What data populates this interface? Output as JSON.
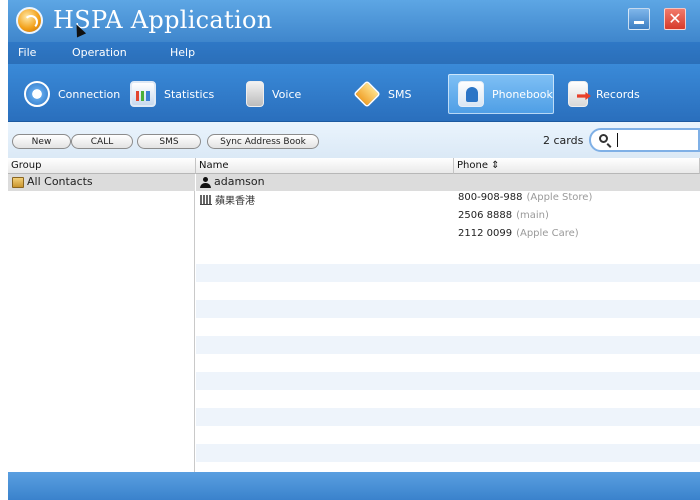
{
  "window": {
    "title": "HSPA Application",
    "close_glyph": "✕"
  },
  "menu": [
    "File",
    "Operation",
    "Help"
  ],
  "toolbar": {
    "items": [
      {
        "label": "Connection",
        "icon": "connection-icon"
      },
      {
        "label": "Statistics",
        "icon": "statistics-icon"
      },
      {
        "label": "Voice",
        "icon": "voice-icon"
      },
      {
        "label": "SMS",
        "icon": "sms-icon"
      },
      {
        "label": "Phonebook",
        "icon": "phonebook-icon",
        "active": true
      },
      {
        "label": "Records",
        "icon": "records-icon"
      }
    ]
  },
  "actions": {
    "buttons": [
      "New",
      "CALL",
      "SMS",
      "Sync Address Book"
    ],
    "count": "2 cards",
    "search_value": ""
  },
  "columns": {
    "group": "Group",
    "name": "Name",
    "phone": "Phone ⇕"
  },
  "groups": [
    {
      "label": "All Contacts",
      "selected": true
    }
  ],
  "contacts": [
    {
      "name": "adamson",
      "company": "蘋果香港",
      "phones": [
        {
          "number": "800-908-988",
          "note": "(Apple Store)"
        },
        {
          "number": "2506 8888",
          "note": "(main)"
        },
        {
          "number": "2112 0099",
          "note": "(Apple Care)"
        }
      ]
    }
  ],
  "colors": {
    "titlebar": "#4a95d9",
    "toolbar": "#2f7bca",
    "active_tab": "#6cb3ef",
    "selected_row": "#dcdcdc"
  }
}
